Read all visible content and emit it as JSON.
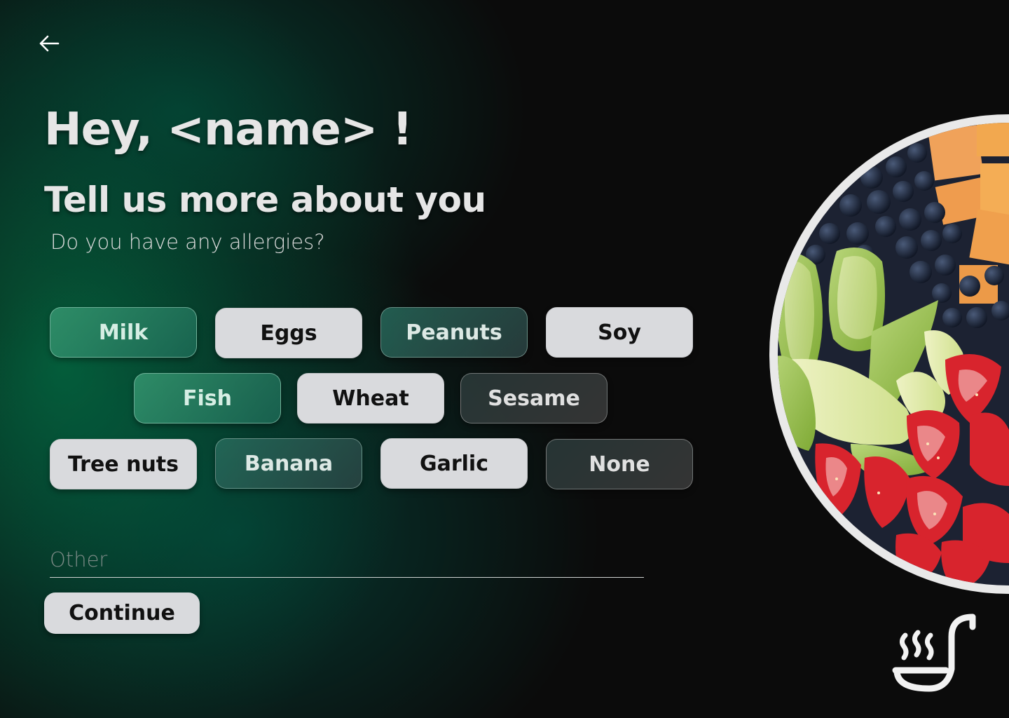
{
  "greeting": {
    "title": "Hey, <name> !",
    "subtitle": "Tell us more about you"
  },
  "question": "Do you have any allergies?",
  "allergy_options": [
    {
      "label": "Milk",
      "style": "teal"
    },
    {
      "label": "Eggs",
      "style": "light"
    },
    {
      "label": "Peanuts",
      "style": "teal-dark"
    },
    {
      "label": "Soy",
      "style": "light"
    },
    {
      "label": "Fish",
      "style": "teal"
    },
    {
      "label": "Wheat",
      "style": "light"
    },
    {
      "label": "Sesame",
      "style": "dark"
    },
    {
      "label": "Tree nuts",
      "style": "light"
    },
    {
      "label": "Banana",
      "style": "teal-dark"
    },
    {
      "label": "Garlic",
      "style": "light"
    },
    {
      "label": "None",
      "style": "dark"
    }
  ],
  "other_field": {
    "placeholder": "Other",
    "value": ""
  },
  "continue_label": "Continue",
  "icons": {
    "back": "arrow-left-icon",
    "logo": "ladle-steam-logo",
    "image": "fruit-bowl-image"
  },
  "colors": {
    "accent_green": "#0a8a5c",
    "chip_light": "#d9dadd",
    "background": "#0b0b0b"
  }
}
